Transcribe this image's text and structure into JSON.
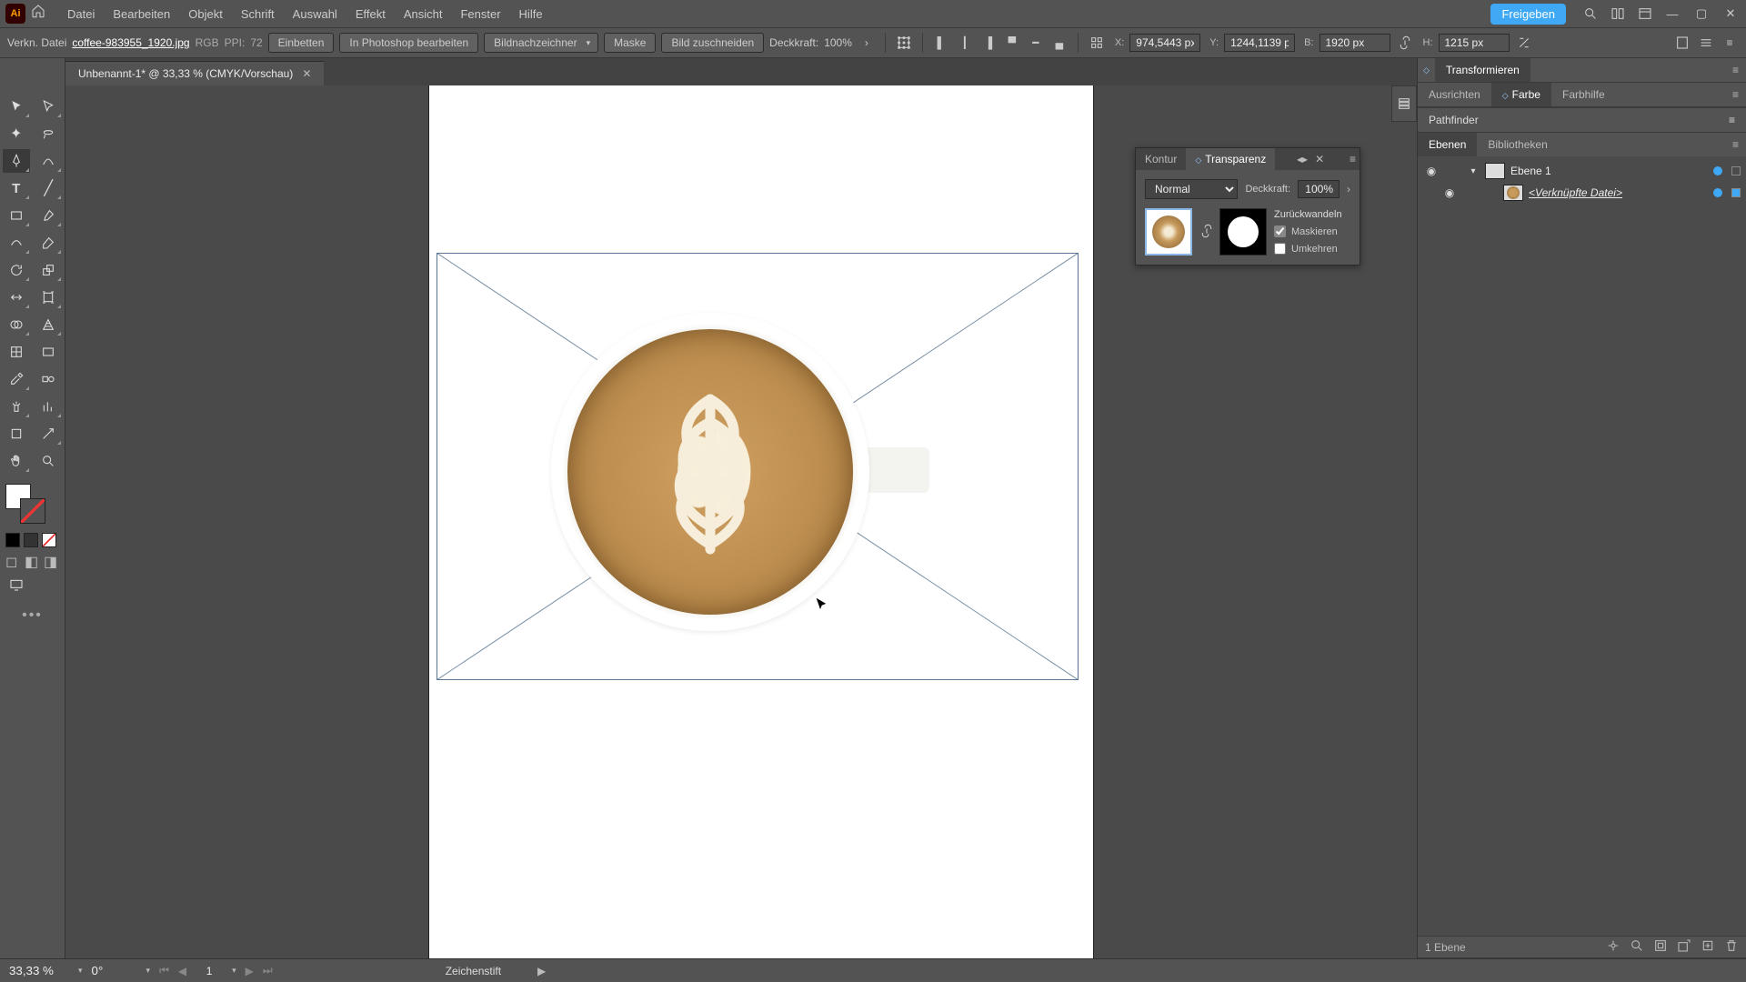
{
  "menu": {
    "items": [
      "Datei",
      "Bearbeiten",
      "Objekt",
      "Schrift",
      "Auswahl",
      "Effekt",
      "Ansicht",
      "Fenster",
      "Hilfe"
    ],
    "share": "Freigeben"
  },
  "opt": {
    "context_label": "Verkn. Datei",
    "filename": "coffee-983955_1920.jpg",
    "color_mode": "RGB",
    "ppi_label": "PPI:",
    "ppi_value": "72",
    "embed": "Einbetten",
    "edit_ps": "In Photoshop bearbeiten",
    "tracer": "Bildnachzeichner",
    "mask": "Maske",
    "crop": "Bild zuschneiden",
    "opacity_label": "Deckkraft:",
    "opacity_value": "100%",
    "x_label": "X:",
    "x_value": "974,5443 px",
    "y_label": "Y:",
    "y_value": "1244,1139 p",
    "w_label": "B:",
    "w_value": "1920 px",
    "h_label": "H:",
    "h_value": "1215 px"
  },
  "doc_tab": "Unbenannt-1* @ 33,33 % (CMYK/Vorschau)",
  "trans_panel": {
    "tabs": [
      "Kontur",
      "Transparenz"
    ],
    "active_tab": 1,
    "blend": "Normal",
    "opacity_label": "Deckkraft:",
    "opacity_value": "100%",
    "revert": "Zurückwandeln",
    "chk_mask": "Maskieren",
    "chk_invert": "Umkehren",
    "mask_checked": true,
    "invert_checked": false
  },
  "right": {
    "transform_tabs": [
      "Transformieren"
    ],
    "align_tabs": [
      "Ausrichten",
      "Farbe",
      "Farbhilfe"
    ],
    "align_active": 1,
    "pathfinder": "Pathfinder",
    "layer_tabs": [
      "Ebenen",
      "Bibliotheken"
    ],
    "layer_active": 0,
    "layer1": "Ebene 1",
    "linked_obj": "<Verknüpfte Datei>",
    "footer_count": "1 Ebene"
  },
  "status": {
    "zoom": "33,33 %",
    "angle": "0°",
    "artboard_index": "1",
    "tool_label": "Zeichenstift"
  }
}
